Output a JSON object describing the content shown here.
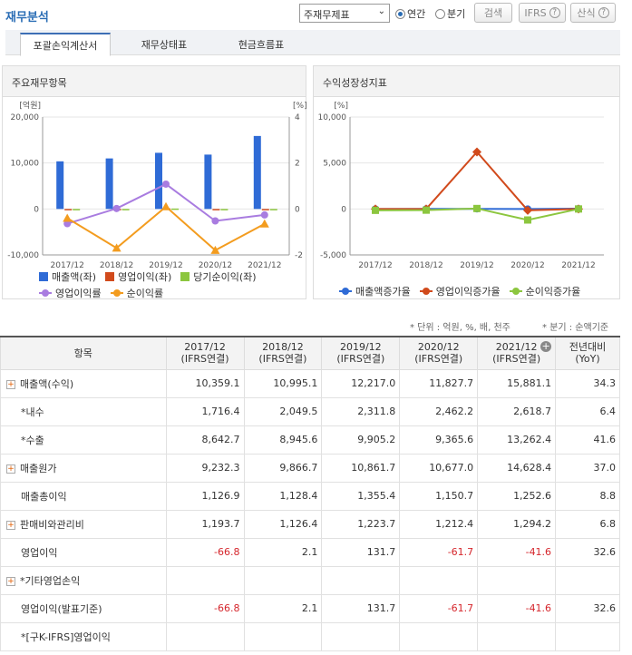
{
  "header": {
    "title": "재무분석",
    "select_value": "주재무제표",
    "radio_annual": "연간",
    "radio_quarter": "분기",
    "search_btn": "검색",
    "ifrs_btn": "IFRS",
    "calc_btn": "산식"
  },
  "tabs": [
    "포괄손익계산서",
    "재무상태표",
    "현금흐름표"
  ],
  "panels": {
    "left_title": "주요재무항목",
    "right_title": "수익성장성지표"
  },
  "chart_data": [
    {
      "type": "bar",
      "categories": [
        "2017/12",
        "2018/12",
        "2019/12",
        "2020/12",
        "2021/12"
      ],
      "ylabel_left": "[억원]",
      "ylabel_right": "[%]",
      "ylim": [
        -10000,
        20000
      ],
      "ylim_right": [
        -2,
        4
      ],
      "left_ticks": [
        "20,000",
        "10,000",
        "0",
        "-10,000"
      ],
      "right_ticks": [
        "4",
        "2",
        "0",
        "-2"
      ],
      "series": [
        {
          "name": "매출액(좌)",
          "color": "#2f6bd6",
          "values": [
            10359.1,
            10995.1,
            12217.0,
            11827.7,
            15881.1
          ]
        },
        {
          "name": "영업이익(좌)",
          "color": "#d14a1c",
          "values": [
            -66.8,
            2.1,
            131.7,
            -61.7,
            -41.6
          ]
        },
        {
          "name": "당기순이익(좌)",
          "color": "#8cc63f",
          "values": [
            -40,
            -45,
            95,
            -120,
            -50
          ]
        },
        {
          "name": "영업이익률",
          "color": "#a97ce0",
          "axis": "right",
          "values": [
            -0.64,
            0.02,
            1.08,
            -0.52,
            -0.26
          ]
        },
        {
          "name": "순이익률",
          "color": "#f39c1f",
          "axis": "right",
          "values": [
            -0.4,
            -1.7,
            0.1,
            -1.8,
            -0.65
          ]
        }
      ]
    },
    {
      "type": "line",
      "categories": [
        "2017/12",
        "2018/12",
        "2019/12",
        "2020/12",
        "2021/12"
      ],
      "ylabel_left": "[%]",
      "ylim": [
        -5000,
        10000
      ],
      "left_ticks": [
        "10,000",
        "5,000",
        "0",
        "-5,000"
      ],
      "series": [
        {
          "name": "매출액증가율",
          "color": "#2f6bd6",
          "values": [
            0,
            6.1,
            11.1,
            -3.2,
            34.3
          ]
        },
        {
          "name": "영업이익증가율",
          "color": "#d14a1c",
          "values": [
            0,
            0,
            6200,
            -146.8,
            0
          ]
        },
        {
          "name": "순이익증가율",
          "color": "#8cc63f",
          "values": [
            -150,
            -130,
            50,
            -1200,
            0
          ]
        }
      ]
    }
  ],
  "notes": {
    "unit": "* 단위 : 억원, %, 배, 천주",
    "quarter": "* 분기 : 순액기준"
  },
  "table": {
    "header_item": "항목",
    "columns": [
      {
        "l1": "2017/12",
        "l2": "(IFRS연결)"
      },
      {
        "l1": "2018/12",
        "l2": "(IFRS연결)"
      },
      {
        "l1": "2019/12",
        "l2": "(IFRS연결)"
      },
      {
        "l1": "2020/12",
        "l2": "(IFRS연결)"
      },
      {
        "l1": "2021/12",
        "l2": "(IFRS연결)"
      },
      {
        "l1": "전년대비",
        "l2": "(YoY)"
      }
    ],
    "rows": [
      {
        "label": "매출액(수익)",
        "expand": true,
        "values": [
          "10,359.1",
          "10,995.1",
          "12,217.0",
          "11,827.7",
          "15,881.1",
          "34.3"
        ]
      },
      {
        "label": "*내수",
        "indent": true,
        "values": [
          "1,716.4",
          "2,049.5",
          "2,311.8",
          "2,462.2",
          "2,618.7",
          "6.4"
        ]
      },
      {
        "label": "*수출",
        "indent": true,
        "values": [
          "8,642.7",
          "8,945.6",
          "9,905.2",
          "9,365.6",
          "13,262.4",
          "41.6"
        ]
      },
      {
        "label": "매출원가",
        "expand": true,
        "values": [
          "9,232.3",
          "9,866.7",
          "10,861.7",
          "10,677.0",
          "14,628.4",
          "37.0"
        ]
      },
      {
        "label": "매출총이익",
        "indent": true,
        "values": [
          "1,126.9",
          "1,128.4",
          "1,355.4",
          "1,150.7",
          "1,252.6",
          "8.8"
        ]
      },
      {
        "label": "판매비와관리비",
        "expand": true,
        "values": [
          "1,193.7",
          "1,126.4",
          "1,223.7",
          "1,212.4",
          "1,294.2",
          "6.8"
        ]
      },
      {
        "label": "영업이익",
        "indent": true,
        "values": [
          "-66.8",
          "2.1",
          "131.7",
          "-61.7",
          "-41.6",
          "32.6"
        ]
      },
      {
        "label": "*기타영업손익",
        "expand": true,
        "values": [
          "",
          "",
          "",
          "",
          "",
          ""
        ]
      },
      {
        "label": "영업이익(발표기준)",
        "indent": true,
        "values": [
          "-66.8",
          "2.1",
          "131.7",
          "-61.7",
          "-41.6",
          "32.6"
        ]
      },
      {
        "label": "*[구K-IFRS]영업이익",
        "indent": true,
        "values": [
          "",
          "",
          "",
          "",
          "",
          ""
        ]
      }
    ]
  }
}
